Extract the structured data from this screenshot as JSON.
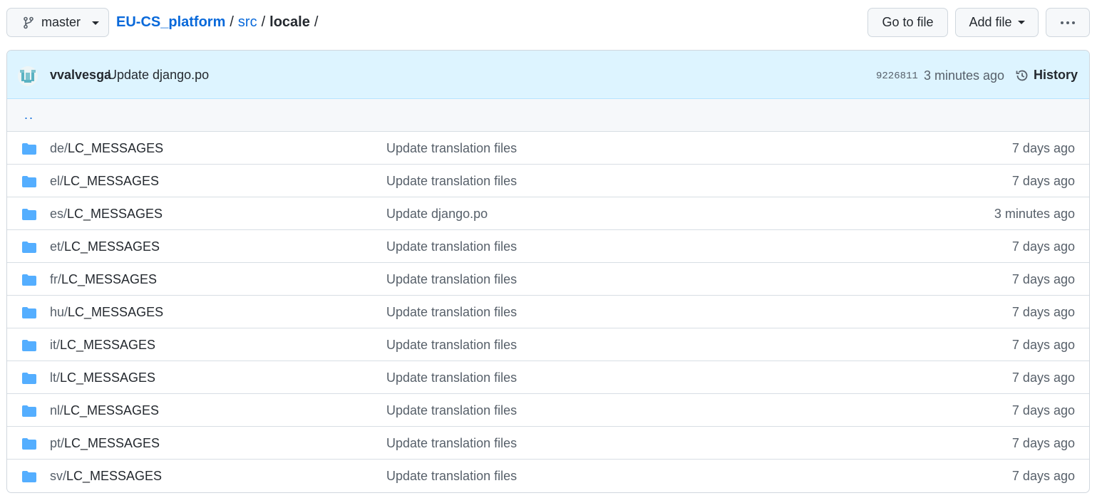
{
  "toolbar": {
    "branch": "master",
    "breadcrumb": {
      "repo": "EU-CS_platform",
      "sep1": "/",
      "dir1": "src",
      "sep2": "/",
      "current": "locale",
      "sep3": "/"
    },
    "go_to_file": "Go to file",
    "add_file": "Add file",
    "more": "···"
  },
  "commit": {
    "author": "vvalvesga",
    "message": "Update django.po",
    "sha": "9226811",
    "time": "3 minutes ago",
    "history_label": "History"
  },
  "parent_link": "..",
  "files": [
    {
      "prefix": "de/",
      "name": "LC_MESSAGES",
      "message": "Update translation files",
      "age": "7 days ago"
    },
    {
      "prefix": "el/",
      "name": "LC_MESSAGES",
      "message": "Update translation files",
      "age": "7 days ago"
    },
    {
      "prefix": "es/",
      "name": "LC_MESSAGES",
      "message": "Update django.po",
      "age": "3 minutes ago"
    },
    {
      "prefix": "et/",
      "name": "LC_MESSAGES",
      "message": "Update translation files",
      "age": "7 days ago"
    },
    {
      "prefix": "fr/",
      "name": "LC_MESSAGES",
      "message": "Update translation files",
      "age": "7 days ago"
    },
    {
      "prefix": "hu/",
      "name": "LC_MESSAGES",
      "message": "Update translation files",
      "age": "7 days ago"
    },
    {
      "prefix": "it/",
      "name": "LC_MESSAGES",
      "message": "Update translation files",
      "age": "7 days ago"
    },
    {
      "prefix": "lt/",
      "name": "LC_MESSAGES",
      "message": "Update translation files",
      "age": "7 days ago"
    },
    {
      "prefix": "nl/",
      "name": "LC_MESSAGES",
      "message": "Update translation files",
      "age": "7 days ago"
    },
    {
      "prefix": "pt/",
      "name": "LC_MESSAGES",
      "message": "Update translation files",
      "age": "7 days ago"
    },
    {
      "prefix": "sv/",
      "name": "LC_MESSAGES",
      "message": "Update translation files",
      "age": "7 days ago"
    }
  ],
  "icons": {
    "branch": "git-branch-icon",
    "folder": "folder-icon",
    "history": "history-icon",
    "avatar": "avatar"
  },
  "colors": {
    "link": "#0969da",
    "folder": "#54aeff",
    "commit_bar": "#ddf4ff"
  }
}
